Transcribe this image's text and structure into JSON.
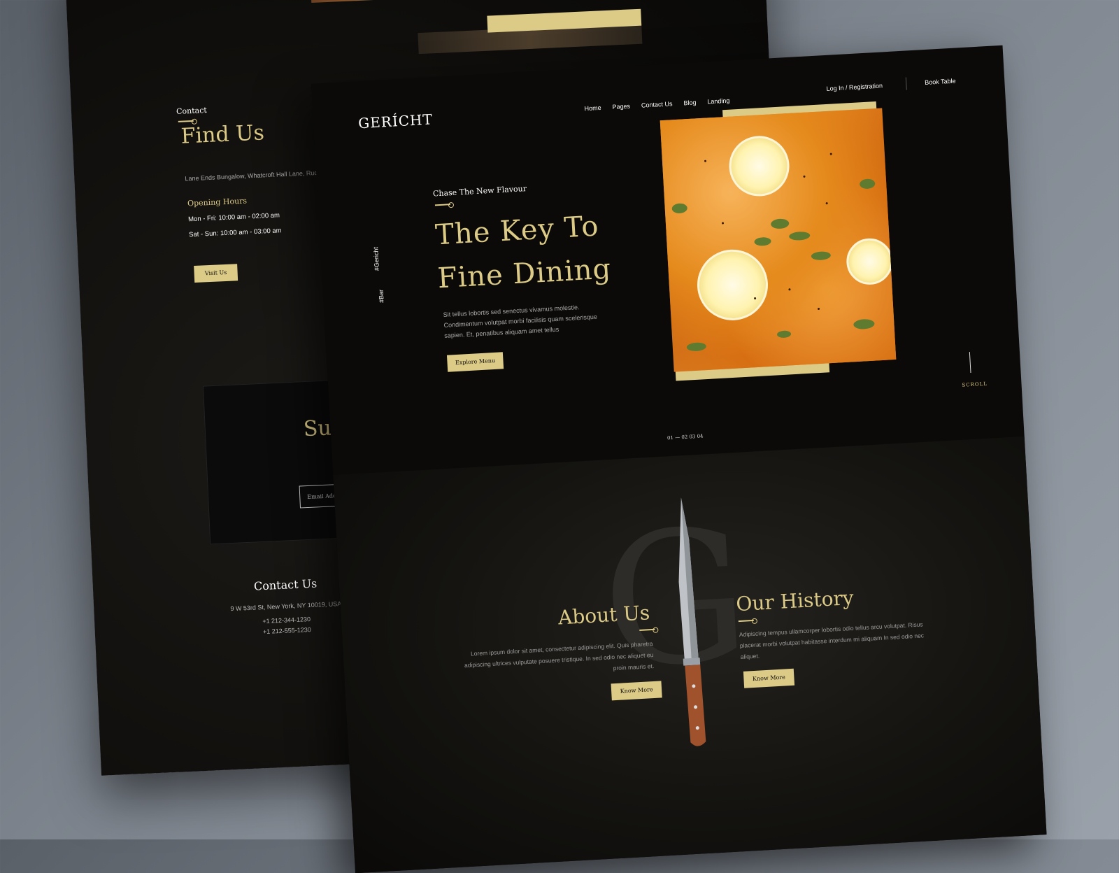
{
  "back": {
    "contact_label": "Contact",
    "find_us": "Find Us",
    "address": "Lane Ends Bungalow, Whatcroft Hall Lane, Rudhe",
    "opening_hours": "Opening Hours",
    "hours_weekday": "Mon - Fri: 10:00 am - 02:00 am",
    "hours_weekend": "Sat - Sun: 10:00 am - 03:00 am",
    "visit_button": "Visit Us",
    "subscribe_title": "Subs",
    "email_placeholder": "Email Address",
    "contact_us_title": "Contact Us",
    "contact_address": "9 W 53rd St, New York, NY 10019, USA",
    "phone_1": "+1 212-344-1230",
    "phone_2": "+1 212-555-1230"
  },
  "front": {
    "logo": "GERÍCHT",
    "nav": [
      "Home",
      "Pages",
      "Contact Us",
      "Blog",
      "Landing"
    ],
    "login": "Log In / Registration",
    "book_table": "Book Table",
    "vertical_1": "#Gericht",
    "vertical_2": "#Bar",
    "hero_subtitle": "Chase The New Flavour",
    "hero_title_1": "The Key To",
    "hero_title_2": "Fine Dining",
    "hero_desc": "Sit tellus lobortis sed senectus vivamus molestie. Condimentum volutpat morbi facilisis quam scelerisque sapien. Et, penatibus aliquam amet tellus",
    "explore_button": "Explore Menu",
    "scroll": "SCROLL",
    "pager": "01 — 02 03 04",
    "about_title": "About Us",
    "about_desc": "Lorem ipsum dolor sit amet, consectetur adipiscing elit. Quis pharetra adipiscing ultrices vulputate posuere tristique. In sed odio nec aliquet eu proin mauris et.",
    "about_button": "Know More",
    "history_title": "Our History",
    "history_desc": "Adipiscing tempus ullamcorper lobortis odio tellus arcu volutpat. Risus placerat morbi volutpat habitasse interdum mi aliquam In sed odio nec aliquet.",
    "history_button": "Know More",
    "bg_letter": "G"
  },
  "colors": {
    "gold": "#dcca87",
    "background": "#0b0a08",
    "backdrop": "#7d848d"
  }
}
